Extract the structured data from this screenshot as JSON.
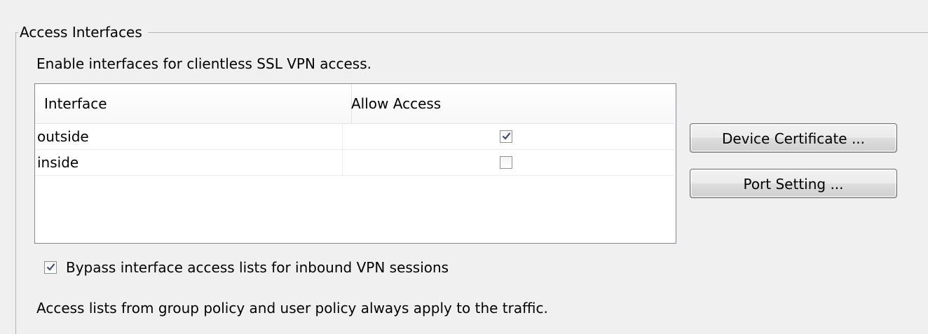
{
  "group": {
    "title": "Access Interfaces",
    "description": "Enable interfaces for clientless SSL VPN access."
  },
  "table": {
    "columns": [
      "Interface",
      "Allow Access"
    ],
    "rows": [
      {
        "interface": "outside",
        "allow_access": true
      },
      {
        "interface": "inside",
        "allow_access": false
      }
    ]
  },
  "buttons": {
    "device_certificate": "Device Certificate ...",
    "port_setting": "Port Setting ..."
  },
  "bypass": {
    "label": "Bypass interface access lists for inbound VPN sessions",
    "checked": true
  },
  "note": "Access lists from group policy and user policy always apply to the traffic.",
  "colors": {
    "window_bg": "#f0f0f0",
    "checkmark": "#3d4f7a",
    "table_border": "#828790"
  }
}
